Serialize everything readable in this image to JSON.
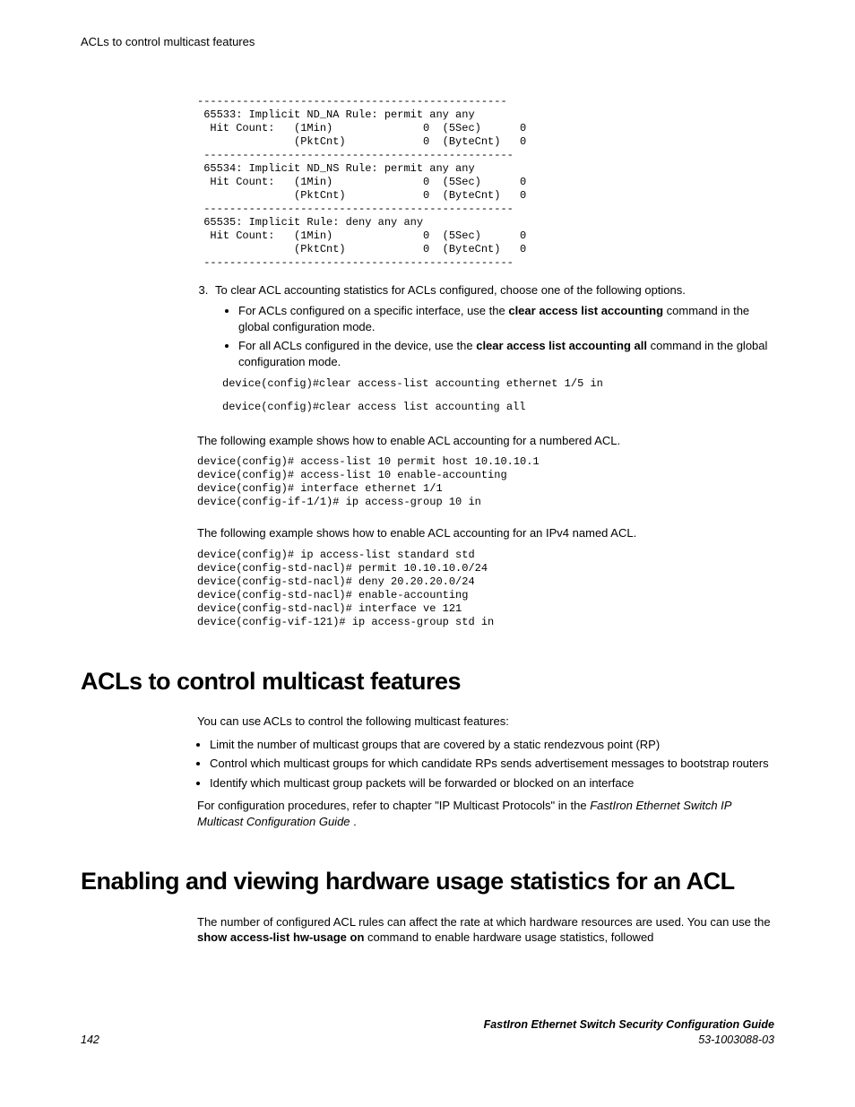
{
  "running_head": "ACLs to control multicast features",
  "code_block_1": "------------------------------------------------\n 65533: Implicit ND_NA Rule: permit any any\n  Hit Count:   (1Min)              0  (5Sec)      0\n               (PktCnt)            0  (ByteCnt)   0\n ------------------------------------------------\n 65534: Implicit ND_NS Rule: permit any any\n  Hit Count:   (1Min)              0  (5Sec)      0\n               (PktCnt)            0  (ByteCnt)   0\n ------------------------------------------------\n 65535: Implicit Rule: deny any any\n  Hit Count:   (1Min)              0  (5Sec)      0\n               (PktCnt)            0  (ByteCnt)   0\n ------------------------------------------------",
  "step3_intro": "To clear ACL accounting statistics for ACLs configured, choose one of the following options.",
  "step3_a_pre": "For ACLs configured on a specific interface, use the ",
  "step3_a_cmd": "clear access list accounting",
  "step3_a_post": " command in the global configuration mode.",
  "step3_b_pre": "For all ACLs configured in the device, use the ",
  "step3_b_cmd": "clear access list accounting all",
  "step3_b_post": " command in the global configuration mode.",
  "code_block_2a": "device(config)#clear access-list accounting ethernet 1/5 in",
  "code_block_2b": "device(config)#clear access list accounting all",
  "example1_intro": "The following example shows how to enable ACL accounting for a numbered ACL.",
  "code_block_3": "device(config)# access-list 10 permit host 10.10.10.1\ndevice(config)# access-list 10 enable-accounting\ndevice(config)# interface ethernet 1/1\ndevice(config-if-1/1)# ip access-group 10 in",
  "example2_intro": "The following example shows how to enable ACL accounting for an IPv4 named ACL.",
  "code_block_4": "device(config)# ip access-list standard std\ndevice(config-std-nacl)# permit 10.10.10.0/24\ndevice(config-std-nacl)# deny 20.20.20.0/24\ndevice(config-std-nacl)# enable-accounting\ndevice(config-std-nacl)# interface ve 121\ndevice(config-vif-121)# ip access-group std in",
  "h2_multicast": "ACLs to control multicast features",
  "multicast_intro": "You can use ACLs to control the following multicast features:",
  "mc_b1": "Limit the number of multicast groups that are covered by a static rendezvous point (RP)",
  "mc_b2": "Control which multicast groups for which candidate RPs sends advertisement messages to bootstrap routers",
  "mc_b3": "Identify which multicast group packets will be forwarded or blocked on an interface",
  "mc_ref_pre": "For configuration procedures, refer to chapter \"IP Multicast Protocols\" in the ",
  "mc_ref_italic": "FastIron Ethernet Switch IP Multicast Configuration Guide",
  "mc_ref_post": " .",
  "h2_hw": "Enabling and viewing hardware usage statistics for an ACL",
  "hw_p1_a": "The number of configured ACL rules can affect the rate at which hardware resources are used. You can use the ",
  "hw_p1_cmd": "show access-list hw-usage on",
  "hw_p1_b": " command to enable hardware usage statistics, followed",
  "footer_page": "142",
  "footer_title": "FastIron Ethernet Switch Security Configuration Guide",
  "footer_doc": "53-1003088-03"
}
